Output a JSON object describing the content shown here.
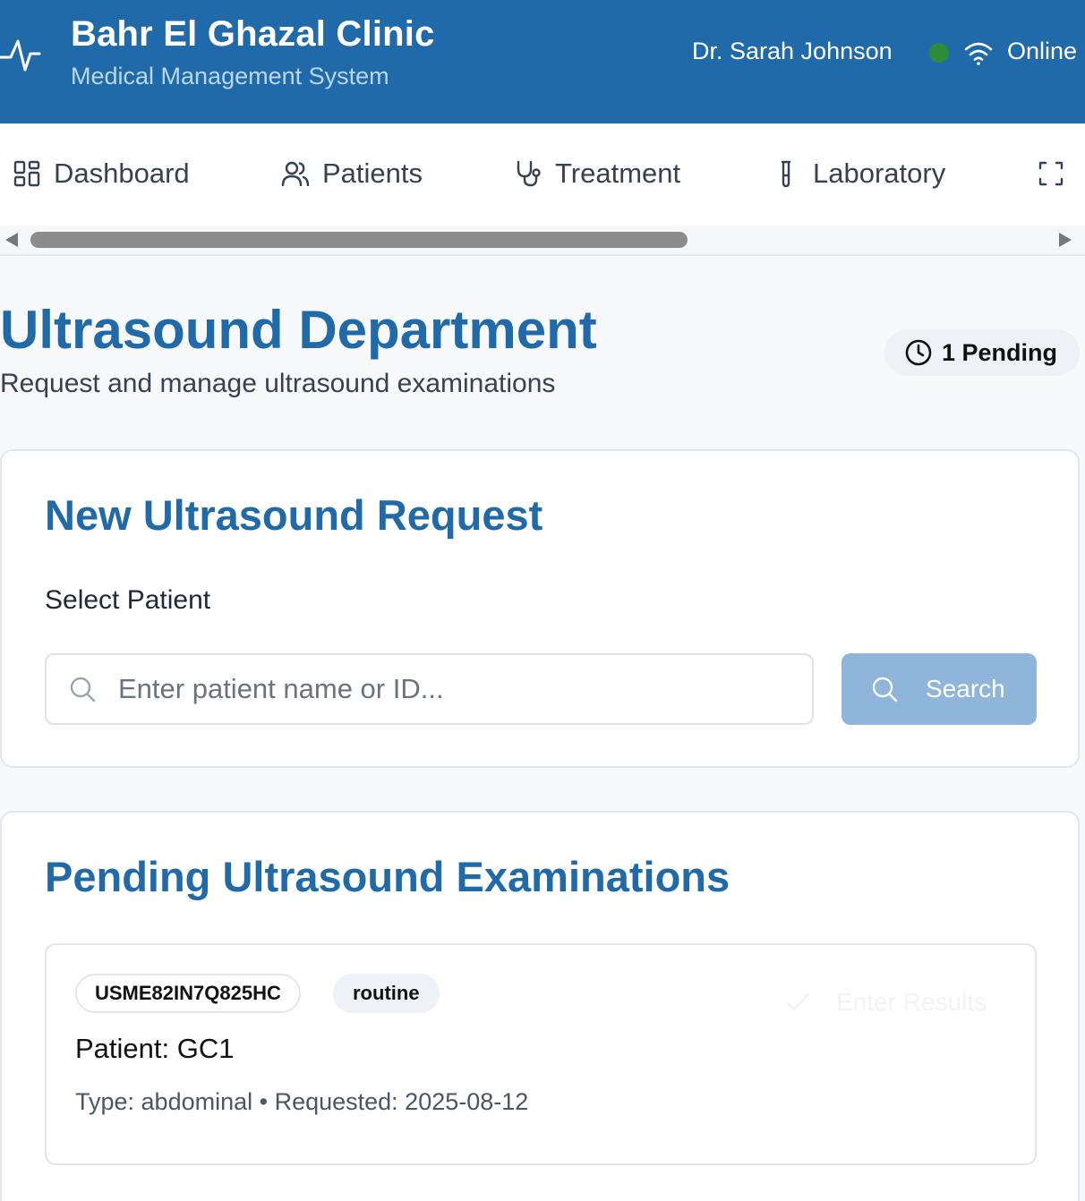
{
  "header": {
    "clinic_name": "Bahr El Ghazal Clinic",
    "clinic_subtitle": "Medical Management System",
    "user_name": "Dr. Sarah Johnson",
    "status_label": "Online",
    "status_color": "#2e8b3a",
    "brand_color": "#206aa9"
  },
  "nav": {
    "items": [
      {
        "label": "Dashboard",
        "icon": "grid-icon"
      },
      {
        "label": "Patients",
        "icon": "users-icon"
      },
      {
        "label": "Treatment",
        "icon": "stethoscope-icon"
      },
      {
        "label": "Laboratory",
        "icon": "test-tube-icon"
      },
      {
        "label": "",
        "icon": "scan-icon"
      }
    ]
  },
  "page": {
    "title": "Ultrasound Department",
    "subtitle": "Request and manage ultrasound examinations",
    "pending_badge": "1 Pending"
  },
  "request_card": {
    "title": "New Ultrasound Request",
    "field_label": "Select Patient",
    "search_placeholder": "Enter patient name or ID...",
    "search_value": "",
    "search_button": "Search"
  },
  "pending_card": {
    "title": "Pending Ultrasound Examinations",
    "exams": [
      {
        "id": "USME82IN7Q825HC",
        "priority": "routine",
        "patient": "Patient: GC1",
        "meta": "Type: abdominal • Requested: 2025-08-12",
        "action": "Enter Results"
      }
    ]
  }
}
